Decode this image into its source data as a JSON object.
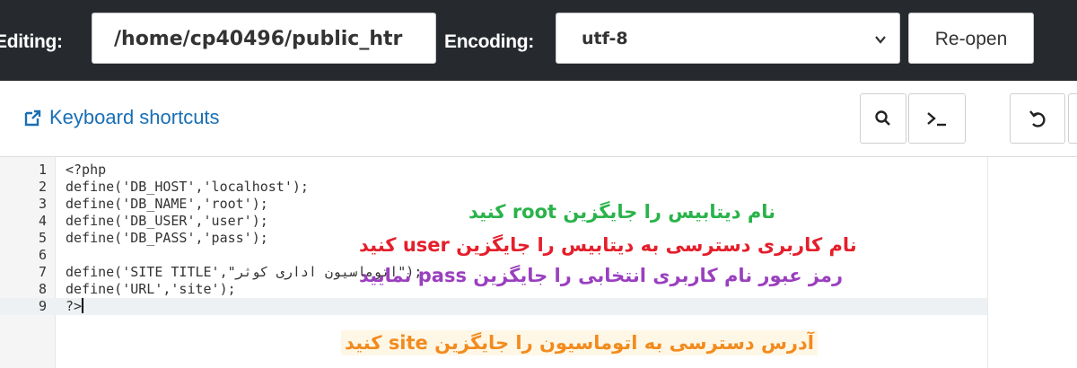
{
  "header": {
    "editing_label": "Editing:",
    "path_value": "/home/cp40496/public_htr",
    "encoding_label": "Encoding:",
    "encoding_value": "utf-8",
    "reopen_label": "Re-open"
  },
  "toolbar": {
    "shortcuts_label": "Keyboard shortcuts",
    "buttons": [
      {
        "name": "search",
        "icon": "search-icon"
      },
      {
        "name": "terminal",
        "icon": "terminal-icon"
      },
      {
        "name": "undo",
        "icon": "undo-icon"
      }
    ]
  },
  "editor": {
    "lines": [
      {
        "num": "1",
        "code": "<?php"
      },
      {
        "num": "2",
        "code": "define('DB_HOST','localhost');"
      },
      {
        "num": "3",
        "code": "define('DB_NAME','root');"
      },
      {
        "num": "4",
        "code": "define('DB_USER','user');"
      },
      {
        "num": "5",
        "code": "define('DB_PASS','pass');"
      },
      {
        "num": "6",
        "code": ""
      },
      {
        "num": "7",
        "code": "define('SITE TITLE',\"اتوماسیون اداری کوثر\");"
      },
      {
        "num": "8",
        "code": "define('URL','site');"
      },
      {
        "num": "9",
        "code": "?>"
      }
    ],
    "active_line": 9
  },
  "annotations": {
    "db_name_note": "نام دیتابیس را جایگزین root کنید",
    "db_user_note": "نام کاربری دسترسی به دیتابیس را جایگزین user کنید",
    "db_pass_note": "رمز عبور نام کاربری انتخابی را جایگزین pass نمایید",
    "url_note": "آدرس دسترسی به اتوماسیون را جایگزین site کنید"
  },
  "colors": {
    "topbar": "#262a2e",
    "link": "#1a6fb4",
    "note_green": "#29b34a",
    "note_red": "#e41f2b",
    "note_purple": "#9a3fbf",
    "note_orange": "#f28b1e"
  }
}
